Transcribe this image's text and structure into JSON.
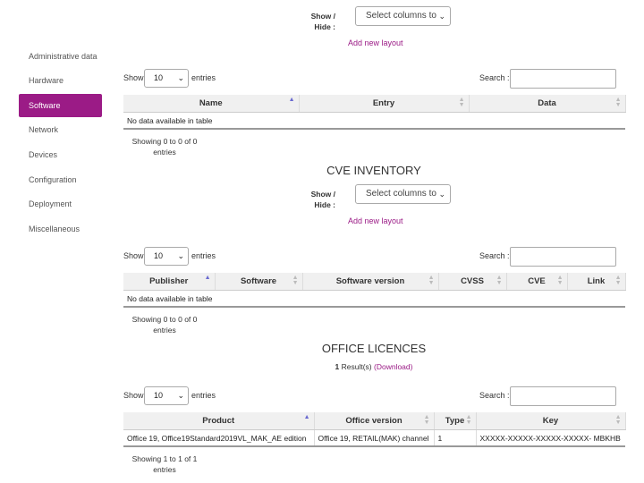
{
  "sidebar": {
    "items": [
      {
        "label": "Administrative data",
        "active": false
      },
      {
        "label": "Hardware",
        "active": false
      },
      {
        "label": "Software",
        "active": true
      },
      {
        "label": "Network",
        "active": false
      },
      {
        "label": "Devices",
        "active": false
      },
      {
        "label": "Configuration",
        "active": false
      },
      {
        "label": "Deployment",
        "active": false
      },
      {
        "label": "Miscellaneous",
        "active": false
      }
    ]
  },
  "common": {
    "show_hide_1": "Show /",
    "show_hide_2": "Hide :",
    "select_columns": "Select columns to",
    "add_layout": "Add new layout",
    "show": "Show",
    "entries": "entries",
    "length_value": "10",
    "search": "Search :"
  },
  "software_table": {
    "columns": [
      "Name",
      "Entry",
      "Data"
    ],
    "empty": "No data available in table",
    "info_1": "Showing 0 to 0 of 0",
    "info_2": "entries"
  },
  "cve": {
    "title": "CVE INVENTORY",
    "columns": [
      "Publisher",
      "Software",
      "Software version",
      "CVSS",
      "CVE",
      "Link"
    ],
    "empty": "No data available in table",
    "info_1": "Showing 0 to 0 of 0",
    "info_2": "entries"
  },
  "office": {
    "title": "OFFICE LICENCES",
    "results_count": "1",
    "results_text": " Result(s) ",
    "download": "(Download)",
    "columns": [
      "Product",
      "Office version",
      "Type",
      "Key"
    ],
    "rows": [
      [
        "Office 19, Office19Standard2019VL_MAK_AE edition",
        "Office 19, RETAIL(MAK) channel",
        "1",
        "XXXXX-XXXXX-XXXXX-XXXXX- MBKHB"
      ]
    ],
    "info_1": "Showing 1 to 1 of 1",
    "info_2": "entries"
  }
}
